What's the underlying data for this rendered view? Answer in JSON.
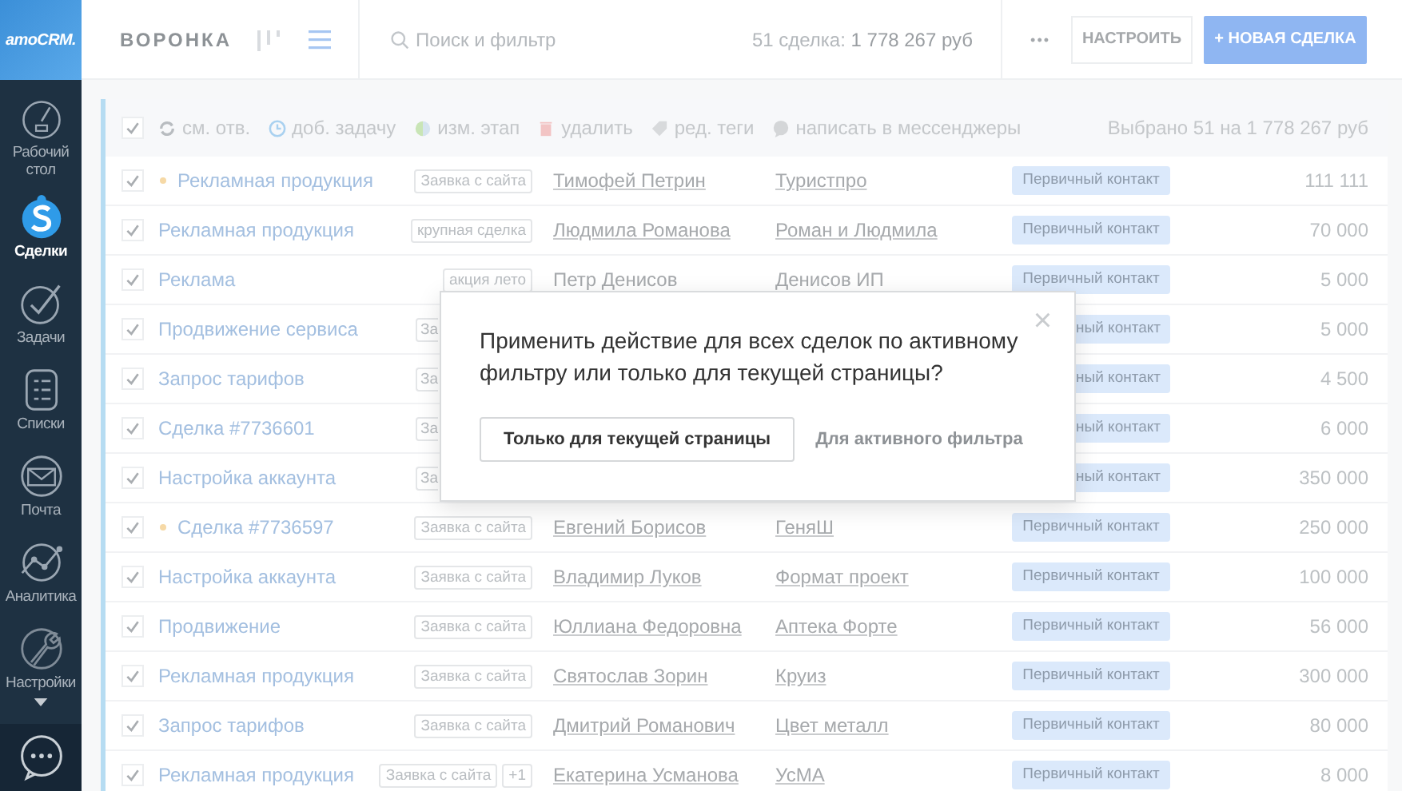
{
  "sidebar": {
    "logo": "amoCRM.",
    "items": [
      {
        "label": "Рабочий стол",
        "kind": "dashboard",
        "selected": false
      },
      {
        "label": "Сделки",
        "kind": "deals",
        "selected": true
      },
      {
        "label": "Задачи",
        "kind": "tasks",
        "selected": false
      },
      {
        "label": "Списки",
        "kind": "lists",
        "selected": false
      },
      {
        "label": "Почта",
        "kind": "mail",
        "selected": false
      },
      {
        "label": "Аналитика",
        "kind": "analytics",
        "selected": false
      },
      {
        "label": "Настройки",
        "kind": "settings",
        "selected": false
      }
    ]
  },
  "header": {
    "title": "ВОРОНКА",
    "views": [
      {
        "kind": "pipeline",
        "selected": false
      },
      {
        "kind": "list",
        "selected": true
      }
    ],
    "search": {
      "placeholder": "Поиск и фильтр"
    },
    "summary_count": "51 сделка:",
    "summary_total": "1 778 267 руб",
    "more": "•••",
    "configure_button": "НАСТРОИТЬ",
    "new_button": "+ НОВАЯ СДЕЛКА"
  },
  "toolbar": {
    "checked": true,
    "actions": [
      {
        "kind": "refresh",
        "label": "см. отв."
      },
      {
        "kind": "clock",
        "label": "доб. задачу"
      },
      {
        "kind": "stage",
        "label": "изм. этап"
      },
      {
        "kind": "trash",
        "label": "удалить"
      },
      {
        "kind": "tag",
        "label": "ред. теги"
      },
      {
        "kind": "chat",
        "label": "написать в мессенджеры"
      }
    ],
    "selected_info": "Выбрано 51 на 1 778 267 руб"
  },
  "rows": [
    {
      "kind": "full",
      "checked": true,
      "dot": true,
      "name": "Рекламная продукция",
      "tags": [
        "Заявка с сайта"
      ],
      "contact": "Тимофей Петрин",
      "company": "Туристпро",
      "linked": true,
      "status": "Первичный контакт",
      "value": "111 111"
    },
    {
      "kind": "full",
      "checked": true,
      "dot": false,
      "name": "Рекламная продукция",
      "tags": [
        "крупная сделка"
      ],
      "contact": "Людмила Романова",
      "company": "Роман и Людмила",
      "linked": true,
      "status": "Первичный контакт",
      "value": "70 000"
    },
    {
      "kind": "full",
      "checked": true,
      "dot": false,
      "name": "Реклама",
      "tags": [
        "акция лето"
      ],
      "contact": "Петр Денисов",
      "company": "Денисов ИП",
      "linked": false,
      "status": "Первичный контакт",
      "value": "5 000"
    },
    {
      "kind": "covered",
      "checked": true,
      "dot": false,
      "name": "Продвижение сервиса",
      "tags": [
        "За"
      ],
      "status": "ный контакт",
      "value": "5 000"
    },
    {
      "kind": "covered",
      "checked": true,
      "dot": false,
      "name": "Запрос тарифов",
      "tags": [
        "За"
      ],
      "status": "ный контакт",
      "value": "4 500"
    },
    {
      "kind": "covered",
      "checked": true,
      "dot": false,
      "name": "Сделка #7736601",
      "tags": [
        "За"
      ],
      "status": "ный контакт",
      "value": "6 000"
    },
    {
      "kind": "covered",
      "checked": true,
      "dot": false,
      "name": "Настройка аккаунта",
      "tags": [
        "За"
      ],
      "status": "ный контакт",
      "value": "350 000"
    },
    {
      "kind": "full",
      "checked": true,
      "dot": true,
      "name": "Сделка #7736597",
      "tags": [
        "Заявка с сайта"
      ],
      "contact": "Евгений Борисов",
      "company": "ГеняШ",
      "linked": true,
      "status": "Первичный контакт",
      "value": "250 000"
    },
    {
      "kind": "full",
      "checked": true,
      "dot": false,
      "name": "Настройка аккаунта",
      "tags": [
        "Заявка с сайта"
      ],
      "contact": "Владимир Луков",
      "company": "Формат проект",
      "linked": true,
      "status": "Первичный контакт",
      "value": "100 000"
    },
    {
      "kind": "full",
      "checked": true,
      "dot": false,
      "name": "Продвижение",
      "tags": [
        "Заявка с сайта"
      ],
      "contact": "Юллиана Федоровна",
      "company": "Аптека Форте",
      "linked": true,
      "status": "Первичный контакт",
      "value": "56 000"
    },
    {
      "kind": "full",
      "checked": true,
      "dot": false,
      "name": "Рекламная продукция",
      "tags": [
        "Заявка с сайта"
      ],
      "contact": "Святослав Зорин",
      "company": "Круиз",
      "linked": true,
      "status": "Первичный контакт",
      "value": "300 000"
    },
    {
      "kind": "full",
      "checked": true,
      "dot": false,
      "name": "Запрос тарифов",
      "tags": [
        "Заявка с сайта"
      ],
      "contact": "Дмитрий Романович",
      "company": "Цвет металл",
      "linked": true,
      "status": "Первичный контакт",
      "value": "80 000"
    },
    {
      "kind": "full",
      "checked": true,
      "dot": false,
      "name": "Рекламная продукция",
      "tags": [
        "Заявка с сайта",
        "+1"
      ],
      "contact": "Екатерина Усманова",
      "company": "УсМА",
      "linked": true,
      "status": "Первичный контакт",
      "value": "8 000"
    }
  ],
  "dialog": {
    "close": "×",
    "message": "Применить действие для всех сделок по активному фильтру или только для текущей страницы?",
    "primary_button": "Только для текущей страницы",
    "secondary_link": "Для активного фильтра"
  }
}
